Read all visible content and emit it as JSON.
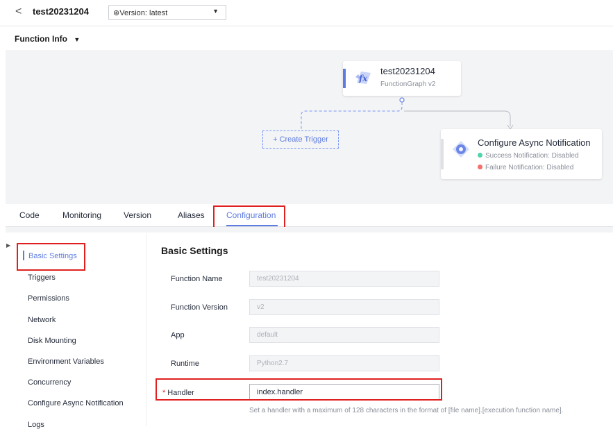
{
  "header": {
    "back_glyph": "<",
    "function_name": "test20231204",
    "version_label": "⊛Version: latest"
  },
  "function_info": {
    "title": "Function Info"
  },
  "diagram": {
    "function_card": {
      "title": "test20231204",
      "subtitle": "FunctionGraph v2"
    },
    "create_trigger_label": "+  Create Trigger",
    "async_card": {
      "title": "Configure Async Notification",
      "success": "Success Notification: Disabled",
      "failure": "Failure Notification: Disabled",
      "success_color": "#50d4ab",
      "failure_color": "#f66f6a"
    }
  },
  "tabs": [
    {
      "label": "Code"
    },
    {
      "label": "Monitoring"
    },
    {
      "label": "Version"
    },
    {
      "label": "Aliases"
    },
    {
      "label": "Configuration",
      "active": true
    }
  ],
  "nav": {
    "items": [
      {
        "label": "Basic Settings",
        "active": true
      },
      {
        "label": "Triggers"
      },
      {
        "label": "Permissions"
      },
      {
        "label": "Network"
      },
      {
        "label": "Disk Mounting"
      },
      {
        "label": "Environment Variables"
      },
      {
        "label": "Concurrency"
      },
      {
        "label": "Configure Async Notification"
      },
      {
        "label": "Logs"
      }
    ]
  },
  "basic_settings": {
    "title": "Basic Settings",
    "fields": [
      {
        "label": "Function Name",
        "value": "test20231204"
      },
      {
        "label": "Function Version",
        "value": "v2"
      },
      {
        "label": "App",
        "value": "default"
      },
      {
        "label": "Runtime",
        "value": "Python2.7"
      }
    ],
    "handler": {
      "required_mark": "*",
      "label": "Handler",
      "value": "index.handler",
      "hint": "Set a handler with a maximum of 128 characters in the format of [file name].[execution function name]."
    }
  },
  "colors": {
    "accent": "#5e7ce0",
    "highlight": "#e02020"
  }
}
